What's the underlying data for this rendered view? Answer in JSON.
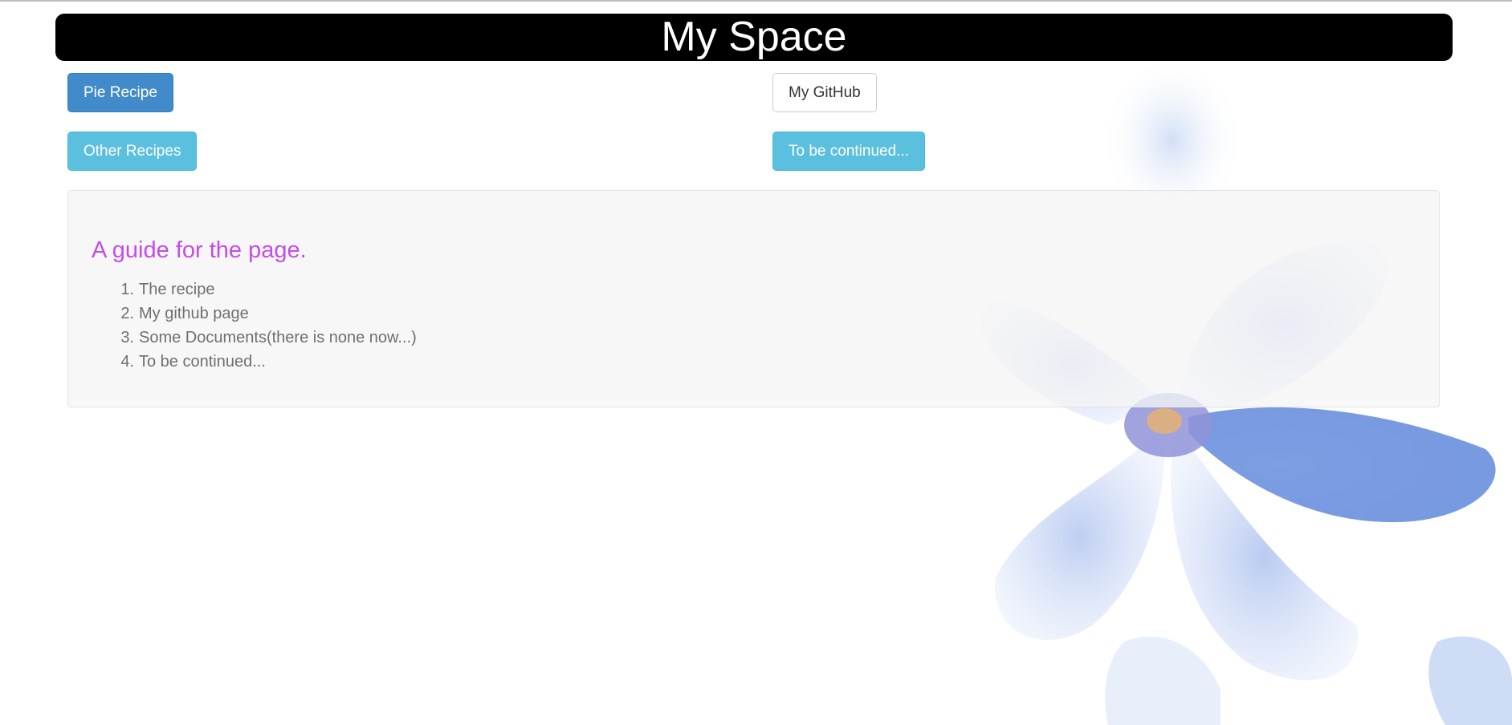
{
  "header": {
    "title": "My Space"
  },
  "buttons": {
    "pie_recipe": "Pie Recipe",
    "my_github": "My GitHub",
    "other_recipes": "Other Recipes",
    "to_be_continued": "To be continued..."
  },
  "guide": {
    "title": "A guide for the page.",
    "items": [
      {
        "num": "1.",
        "text": "The recipe"
      },
      {
        "num": "2.",
        "text": "My github page"
      },
      {
        "num": "3.",
        "text": "Some Documents(there is none now...)"
      },
      {
        "num": "4.",
        "text": "To be continued..."
      }
    ]
  },
  "colors": {
    "header_bg": "#000000",
    "primary": "#428bca",
    "info": "#5bc0de",
    "guide_title": "#c54ce8"
  }
}
